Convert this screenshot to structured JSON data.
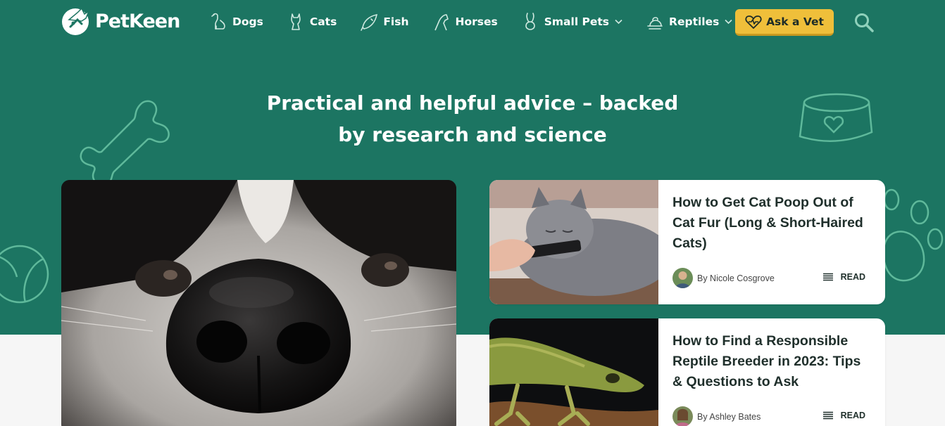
{
  "brand": {
    "name": "PetKeen"
  },
  "nav": {
    "items": [
      {
        "label": "Dogs",
        "icon": "dog-icon"
      },
      {
        "label": "Cats",
        "icon": "cat-icon"
      },
      {
        "label": "Fish",
        "icon": "fish-icon"
      },
      {
        "label": "Horses",
        "icon": "horse-icon"
      },
      {
        "label": "Small Pets",
        "icon": "rabbit-icon",
        "has_dropdown": true
      },
      {
        "label": "Reptiles",
        "icon": "reptile-icon",
        "has_dropdown": true
      }
    ],
    "cta_label": "Ask a Vet",
    "cta_icon": "heart-pulse-icon",
    "search_icon": "search-icon"
  },
  "hero": {
    "headline_line1": "Practical and helpful advice – backed",
    "headline_line2": "by research and science"
  },
  "articles": [
    {
      "title": "How to Get Cat Poop Out of Cat Fur (Long & Short-Haired Cats)",
      "byline": "By Nicole Cosgrove",
      "read_label": "READ"
    },
    {
      "title": "How to Find a Responsible Reptile Breeder in 2023: Tips & Questions to Ask",
      "byline": "By Ashley Bates",
      "read_label": "READ"
    }
  ],
  "colors": {
    "hero_green": "#1c7562",
    "cta_yellow": "#efbf3a",
    "deco_outline": "#5fb99b"
  }
}
